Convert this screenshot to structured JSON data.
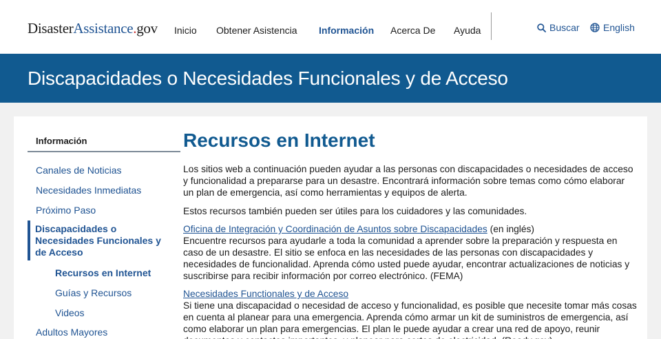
{
  "logo": {
    "part1": "Disaster",
    "part2": "Assistance",
    "dot": ".",
    "part3": "gov"
  },
  "nav": [
    {
      "label": "Inicio"
    },
    {
      "label": "Obtener Asistencia"
    },
    {
      "label": "Información"
    },
    {
      "label": "Acerca De"
    },
    {
      "label": "Ayuda"
    }
  ],
  "utility": {
    "search_label": "Buscar",
    "language_label": "English"
  },
  "icons": {
    "search": "search-icon",
    "language": "globe-icon"
  },
  "colors": {
    "brand_blue": "#115a90",
    "link_blue": "#205493",
    "logo_dot": "#c62828"
  },
  "banner": {
    "title": "Discapacidades o Necesidades Funcionales y de Acceso"
  },
  "sidebar": {
    "title": "Información",
    "items": [
      {
        "label": "Canales de Noticias"
      },
      {
        "label": "Necesidades Inmediatas"
      },
      {
        "label": "Próximo Paso"
      },
      {
        "label": "Discapacidades o Necesidades Funcionales y de Acceso"
      },
      {
        "label": "Recursos en Internet"
      },
      {
        "label": "Guías y Recursos"
      },
      {
        "label": "Videos"
      },
      {
        "label": "Adultos Mayores"
      }
    ]
  },
  "main": {
    "title": "Recursos en Internet",
    "intro": "Los sitios web a continuación pueden ayudar a las personas con discapacidades o necesidades de acceso y funcionalidad a prepararse para un desastre. Encontrará información sobre temas como cómo elaborar un plan de emergencia, así como herramientas y equipos de alerta.",
    "intro2": "Estos recursos también pueden ser útiles para los cuidadores y las comunidades.",
    "resources": [
      {
        "link": "Oficina de Integración y Coordinación de Asuntos sobre Discapacidades",
        "suffix": " (en inglés)",
        "description": "Encuentre recursos para ayudarle a toda la comunidad a aprender sobre la preparación y respuesta en caso de un desastre. El sitio se enfoca en las necesidades de las personas con discapacidades y necesidades de funcionalidad. Aprenda cómo usted puede ayudar, encontrar actualizaciones de noticias y suscribirse para recibir información por correo electrónico. (FEMA)"
      },
      {
        "link": "Necesidades Functionales y de Acceso",
        "suffix": "",
        "description": "Si tiene una discapacidad o necesidad de acceso y funcionalidad, es posible que necesite tomar más cosas en cuenta al planear para una emergencia. Aprenda cómo armar un kit de suministros de emergencia, así como elaborar un plan para emergencias. El plan le puede ayudar a crear una red de apoyo, reunir documentos y contactos importantes, y planear para cortes de electricidad. (Ready.gov)"
      }
    ]
  }
}
